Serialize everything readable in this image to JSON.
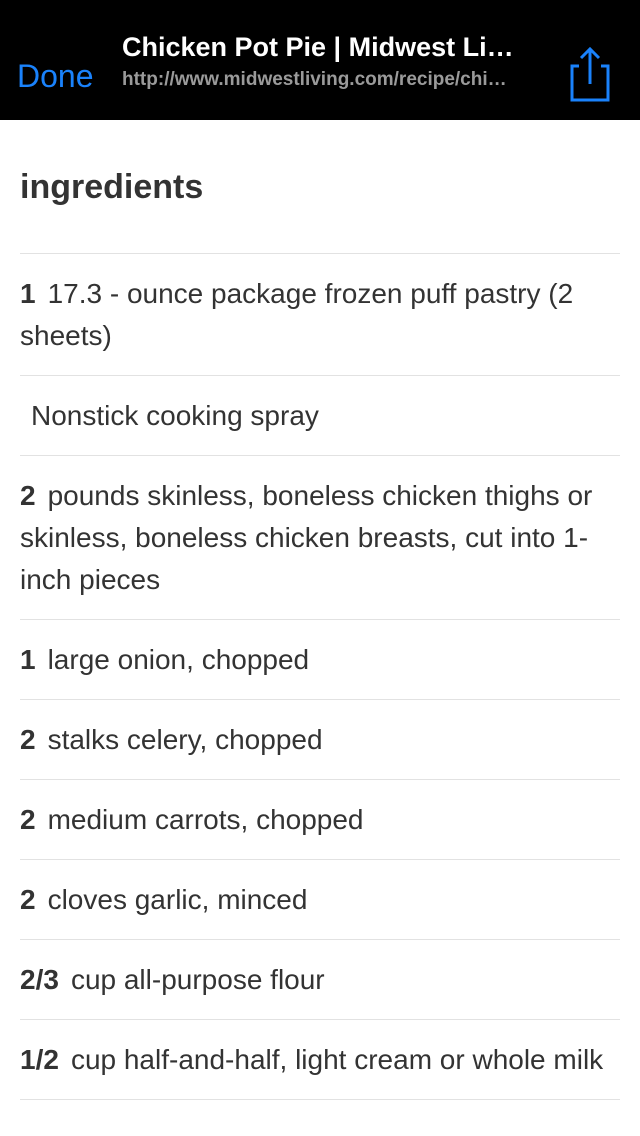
{
  "navbar": {
    "done_label": "Done",
    "title": "Chicken Pot Pie | Midwest Living",
    "url": "http://www.midwestliving.com/recipe/chicken-pot-pie",
    "share_icon": "share-icon",
    "accent_color": "#1a82fb"
  },
  "content": {
    "heading": "ingredients",
    "ingredients": [
      {
        "qty": "1",
        "text": "17.3 - ounce package frozen puff pastry (2 sheets)"
      },
      {
        "qty": "",
        "text": "Nonstick cooking spray"
      },
      {
        "qty": "2",
        "text": "pounds skinless, boneless chicken thighs or skinless, boneless chicken breasts, cut into 1-inch pieces"
      },
      {
        "qty": "1",
        "text": "large onion, chopped"
      },
      {
        "qty": "2",
        "text": "stalks celery, chopped"
      },
      {
        "qty": "2",
        "text": "medium carrots, chopped"
      },
      {
        "qty": "2",
        "text": "cloves garlic, minced"
      },
      {
        "qty": "2/3",
        "text": "cup all-purpose flour"
      },
      {
        "qty": "1/2",
        "text": "cup half-and-half, light cream or whole milk"
      }
    ]
  }
}
